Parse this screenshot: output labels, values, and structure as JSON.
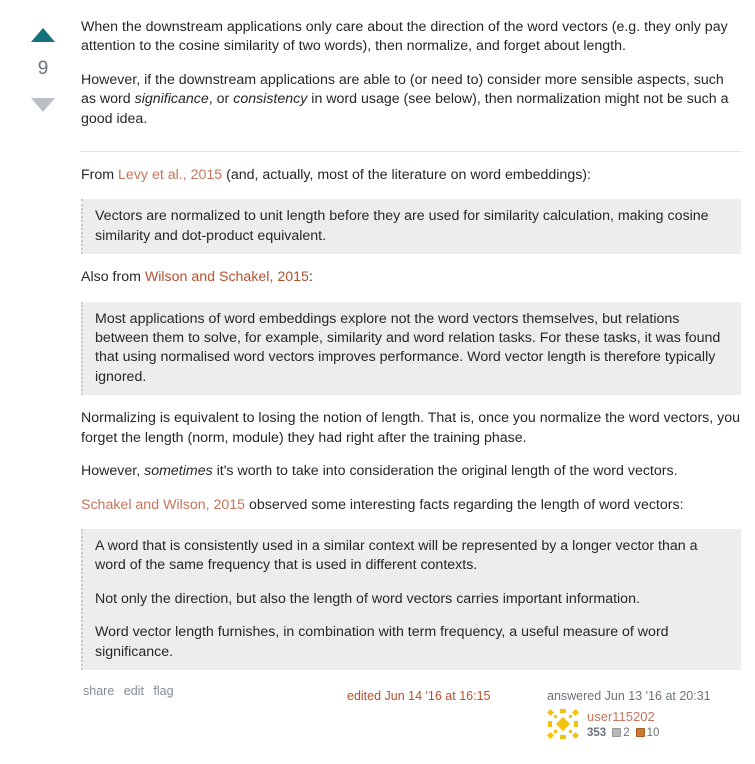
{
  "vote": {
    "count": "9",
    "up_icon": "arrow-up-icon",
    "down_icon": "arrow-down-icon",
    "up_color": "#14727a",
    "down_color": "#bbc0c4"
  },
  "answer": {
    "p1": "When the downstream applications only care about the direction of the word vectors (e.g. they only pay attention to the cosine similarity of two words), then normalize, and forget about length.",
    "p2_a": "However, if the downstream applications are able to (or need to) consider more sensible aspects, such as word ",
    "p2_em1": "significance",
    "p2_b": ", or ",
    "p2_em2": "consistency",
    "p2_c": " in word usage (see below), then normalization might not be such a good idea.",
    "p3_a": "From ",
    "p3_link": "Levy et al., 2015",
    "p3_b": " (and, actually, most of the literature on word embeddings):",
    "quote1": "Vectors are normalized to unit length before they are used for similarity calculation, making cosine similarity and dot-product equivalent.",
    "p4_a": "Also from ",
    "p4_link": "Wilson and Schakel, 2015",
    "p4_b": ":",
    "quote2": "Most applications of word embeddings explore not the word vectors themselves, but relations between them to solve, for example, similarity and word relation tasks. For these tasks, it was found that using normalised word vectors improves performance. Word vector length is therefore typically ignored.",
    "p5": "Normalizing is equivalent to losing the notion of length. That is, once you normalize the word vectors, you forget the length (norm, module) they had right after the training phase.",
    "p6_a": "However, ",
    "p6_em": "sometimes",
    "p6_b": " it's worth to take into consideration the original length of the word vectors.",
    "p7_link": "Schakel and Wilson, 2015",
    "p7_b": " observed some interesting facts regarding the length of word vectors:",
    "quote3_p1": "A word that is consistently used in a similar context will be represented by a longer vector than a word of the same frequency that is used in different contexts.",
    "quote3_p2": "Not only the direction, but also the length of word vectors carries important information.",
    "quote3_p3": "Word vector length furnishes, in combination with term frequency, a useful measure of word significance."
  },
  "footer": {
    "menu": [
      "share",
      "edit",
      "flag"
    ],
    "edited": "edited Jun 14 '16 at 16:15",
    "answered": "answered Jun 13 '16 at 20:31",
    "user": {
      "name": "user115202",
      "reputation": "353",
      "silver_badges": "2",
      "bronze_badges": "10",
      "avatar_icon": "identicon-avatar-icon",
      "avatar_color": "#f2c40f"
    }
  },
  "colors": {
    "link": "#c7745d",
    "text": "#242729",
    "quote_bg": "#ededed"
  }
}
